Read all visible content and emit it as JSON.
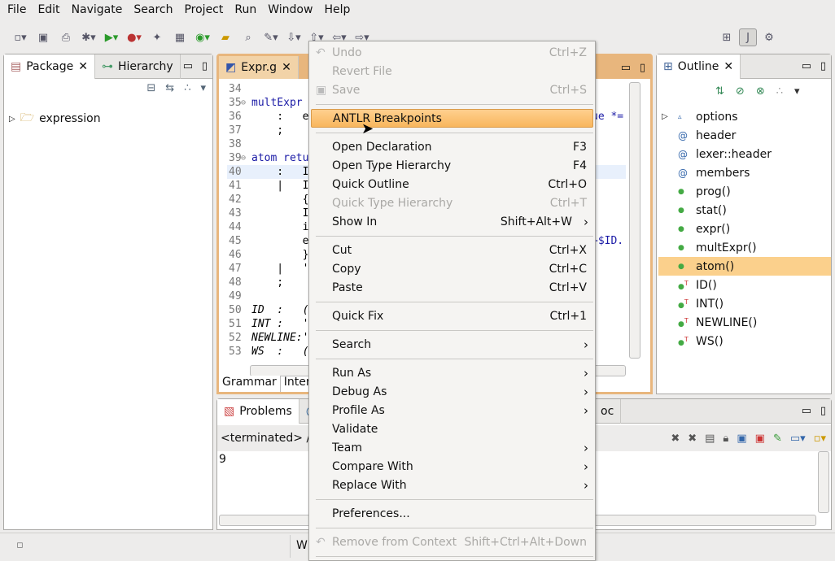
{
  "menubar": [
    "File",
    "Edit",
    "Navigate",
    "Search",
    "Project",
    "Run",
    "Window",
    "Help"
  ],
  "left_panel": {
    "tabs": [
      "Package",
      "Hierarchy"
    ],
    "tree": [
      {
        "label": "expression"
      }
    ]
  },
  "editor": {
    "tab": "Expr.g",
    "bottom_tabs": [
      "Grammar",
      "Interp"
    ],
    "lines": [
      {
        "n": "34",
        "t": ""
      },
      {
        "n": "35",
        "t": "multExpr",
        "fold": true
      },
      {
        "n": "36",
        "t": "    :   e",
        "r": "ue *="
      },
      {
        "n": "37",
        "t": "    ;"
      },
      {
        "n": "38",
        "t": ""
      },
      {
        "n": "39",
        "t": "atom retu",
        "fold": true
      },
      {
        "n": "40",
        "t": "    :   I",
        "current": true
      },
      {
        "n": "41",
        "t": "    |   I"
      },
      {
        "n": "42",
        "t": "        {"
      },
      {
        "n": "43",
        "t": "        I"
      },
      {
        "n": "44",
        "t": "        i"
      },
      {
        "n": "45",
        "t": "        e",
        "r": "+$ID."
      },
      {
        "n": "46",
        "t": "        }"
      },
      {
        "n": "47",
        "t": "    |   '"
      },
      {
        "n": "48",
        "t": "    ;"
      },
      {
        "n": "49",
        "t": ""
      },
      {
        "n": "50",
        "t": "ID  :   ("
      },
      {
        "n": "51",
        "t": "INT :   '"
      },
      {
        "n": "52",
        "t": "NEWLINE:'"
      },
      {
        "n": "53",
        "t": "WS  :   ("
      }
    ]
  },
  "outline": {
    "tab": "Outline",
    "items": [
      {
        "label": "options",
        "icon": "options-icon"
      },
      {
        "label": "header",
        "icon": "at-icon"
      },
      {
        "label": "lexer::header",
        "icon": "at-icon"
      },
      {
        "label": "members",
        "icon": "at-icon"
      },
      {
        "label": "prog()",
        "icon": "rule-icon"
      },
      {
        "label": "stat()",
        "icon": "rule-icon"
      },
      {
        "label": "expr()",
        "icon": "rule-icon"
      },
      {
        "label": "multExpr()",
        "icon": "rule-icon"
      },
      {
        "label": "atom()",
        "icon": "rule-icon",
        "selected": true
      },
      {
        "label": "ID()",
        "icon": "token-icon"
      },
      {
        "label": "INT()",
        "icon": "token-icon"
      },
      {
        "label": "NEWLINE()",
        "icon": "token-icon"
      },
      {
        "label": "WS()",
        "icon": "token-icon"
      }
    ]
  },
  "bottom": {
    "tabs": [
      "Problems",
      "@",
      "oc"
    ],
    "console_header": "<terminated> /u",
    "output": "9"
  },
  "status": {
    "text": "W"
  },
  "context_menu": [
    {
      "label": "Undo",
      "acc": "Ctrl+Z",
      "disabled": true
    },
    {
      "label": "Revert File",
      "disabled": true
    },
    {
      "label": "Save",
      "acc": "Ctrl+S",
      "disabled": true
    },
    {
      "sep": true
    },
    {
      "label": "ANTLR Breakpoints",
      "highlight": true
    },
    {
      "sep": true
    },
    {
      "label": "Open Declaration",
      "acc": "F3"
    },
    {
      "label": "Open Type Hierarchy",
      "acc": "F4"
    },
    {
      "label": "Quick Outline",
      "acc": "Ctrl+O"
    },
    {
      "label": "Quick Type Hierarchy",
      "acc": "Ctrl+T",
      "disabled": true
    },
    {
      "label": "Show In",
      "acc": "Shift+Alt+W",
      "sub": true
    },
    {
      "sep": true
    },
    {
      "label": "Cut",
      "acc": "Ctrl+X"
    },
    {
      "label": "Copy",
      "acc": "Ctrl+C"
    },
    {
      "label": "Paste",
      "acc": "Ctrl+V"
    },
    {
      "sep": true
    },
    {
      "label": "Quick Fix",
      "acc": "Ctrl+1"
    },
    {
      "sep": true
    },
    {
      "label": "Search",
      "sub": true
    },
    {
      "sep": true
    },
    {
      "label": "Run As",
      "sub": true
    },
    {
      "label": "Debug As",
      "sub": true
    },
    {
      "label": "Profile As",
      "sub": true
    },
    {
      "label": "Validate"
    },
    {
      "label": "Team",
      "sub": true
    },
    {
      "label": "Compare With",
      "sub": true
    },
    {
      "label": "Replace With",
      "sub": true
    },
    {
      "sep": true
    },
    {
      "label": "Preferences..."
    },
    {
      "sep": true
    },
    {
      "label": "Remove from Context",
      "acc": "Shift+Ctrl+Alt+Down",
      "disabled": true
    },
    {
      "sep": true
    }
  ]
}
